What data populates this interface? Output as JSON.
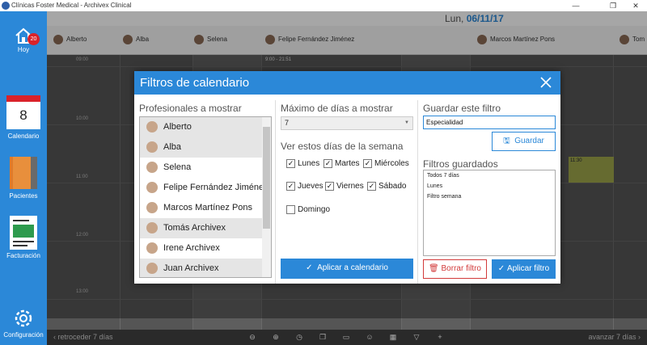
{
  "window": {
    "title": "Clínicas Foster Medical - Archivex Clinical",
    "controls": [
      "—",
      "❐",
      "✕"
    ]
  },
  "sidebar": {
    "items": [
      {
        "label": "Hoy",
        "icon": "home-icon",
        "badge": "20"
      },
      {
        "label": "Calendario",
        "icon": "calendar-icon",
        "day": "8"
      },
      {
        "label": "Pacientes",
        "icon": "folders-icon"
      },
      {
        "label": "Facturación",
        "icon": "invoice-icon"
      },
      {
        "label": "Configuración",
        "icon": "gear-icon"
      }
    ]
  },
  "calendar": {
    "weekday": "Lun,",
    "date": "06/11/17",
    "professionals": [
      "Alberto",
      "Alba",
      "Selena",
      "Felipe Fernández Jiménez",
      "Marcos Martínez Pons",
      "Tom"
    ],
    "range_label": "9:00 - 21:51",
    "times": [
      "09:00",
      "10:00",
      "11:00",
      "12:00",
      "13:00"
    ],
    "appointment": "11:30"
  },
  "toolbar": {
    "back": "retroceder 7 días",
    "forward": "avanzar 7 días",
    "icons": [
      "zoom-out-icon",
      "zoom-in-icon",
      "clock-icon",
      "copy-icon",
      "card-icon",
      "people-icon",
      "calendar-grid-icon",
      "filter-icon",
      "plus-icon"
    ]
  },
  "dialog": {
    "title": "Filtros de calendario",
    "professionals_label": "Profesionales a mostrar",
    "professionals": [
      {
        "name": "Alberto",
        "selected": true
      },
      {
        "name": "Alba",
        "selected": true
      },
      {
        "name": "Selena",
        "selected": false
      },
      {
        "name": "Felipe Fernández Jiménez",
        "selected": false
      },
      {
        "name": "Marcos Martínez Pons",
        "selected": false
      },
      {
        "name": "Tomás Archivex",
        "selected": true
      },
      {
        "name": "Irene Archivex",
        "selected": false
      },
      {
        "name": "Juan Archivex",
        "selected": true
      }
    ],
    "max_days_label": "Máximo de días a mostrar",
    "max_days_value": "7",
    "weekdays_label": "Ver estos días de la semana",
    "days": [
      {
        "label": "Lunes",
        "checked": true
      },
      {
        "label": "Martes",
        "checked": true
      },
      {
        "label": "Miércoles",
        "checked": true
      },
      {
        "label": "Jueves",
        "checked": true
      },
      {
        "label": "Viernes",
        "checked": true
      },
      {
        "label": "Sábado",
        "checked": true
      },
      {
        "label": "Domingo",
        "checked": false
      }
    ],
    "apply_calendar": "Aplicar a calendario",
    "save_filter_label": "Guardar este filtro",
    "filter_name_value": "Especialidad",
    "save_button": "Guardar",
    "saved_filters_label": "Filtros guardados",
    "saved_filters": [
      "Todos 7 días",
      "Lunes",
      "Filtro semana"
    ],
    "delete_button": "Borrar filtro",
    "apply_filter_button": "Aplicar filtro"
  },
  "colors": {
    "accent": "#2b88d8",
    "danger": "#d23a3a",
    "badge": "#d9222a"
  }
}
